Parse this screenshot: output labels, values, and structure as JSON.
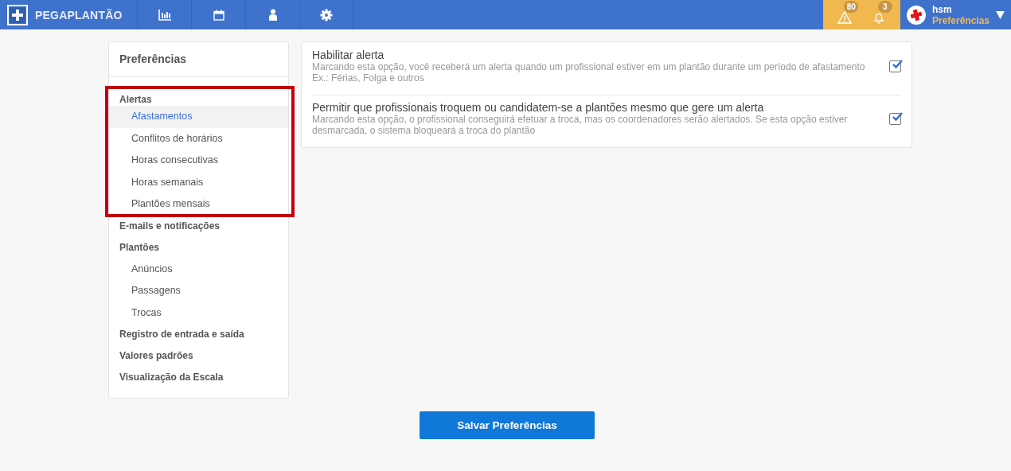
{
  "topbar": {
    "logo": "PEGAPLANTÃO",
    "nav": [
      {
        "kind": "chart"
      },
      {
        "kind": "calendar"
      },
      {
        "kind": "person"
      },
      {
        "kind": "gear"
      }
    ],
    "alerts": [
      {
        "kind": "warning",
        "count": "80"
      },
      {
        "kind": "bell",
        "count": "3"
      }
    ],
    "user": {
      "name": "hsm",
      "subtitle": "Preferências"
    }
  },
  "sidebar": {
    "title": "Preferências",
    "groups": [
      {
        "label": "Alertas",
        "highlighted": true,
        "items": [
          {
            "label": "Afastamentos",
            "selected": true
          },
          {
            "label": "Conflitos de horários",
            "selected": false
          },
          {
            "label": "Horas consecutivas",
            "selected": false
          },
          {
            "label": "Horas semanais",
            "selected": false
          },
          {
            "label": "Plantões mensais",
            "selected": false
          }
        ]
      },
      {
        "label": "E-mails e notificações"
      },
      {
        "label": "Plantões",
        "items": [
          {
            "label": "Anúncios",
            "selected": false
          },
          {
            "label": "Passagens",
            "selected": false
          },
          {
            "label": "Trocas",
            "selected": false
          }
        ]
      },
      {
        "label": "Registro de entrada e saída"
      },
      {
        "label": "Valores padrões"
      },
      {
        "label": "Visualização da Escala"
      }
    ]
  },
  "settings": [
    {
      "title": "Habilitar alerta",
      "description": "Marcando esta opção, você receberá um alerta quando um profissional estiver em um plantão durante um período de afastamento Ex.: Férias, Folga e outros",
      "checked": true
    },
    {
      "title": "Permitir que profissionais troquem ou candidatem-se a plantões mesmo que gere um alerta",
      "description": "Marcando esta opção, o profissional conseguirá efetuar a troca, mas os coordenadores serão alertados. Se esta opção estiver desmarcada, o sistema bloqueará a troca do plantão",
      "checked": true
    }
  ],
  "save_button": "Salvar Preferências"
}
